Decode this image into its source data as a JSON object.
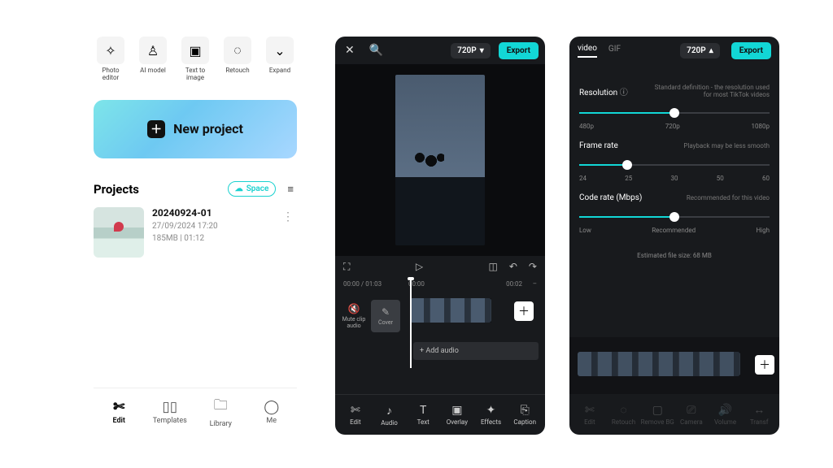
{
  "home": {
    "tools": [
      {
        "label": "Photo editor",
        "icon": "✧"
      },
      {
        "label": "AI model",
        "icon": "♙"
      },
      {
        "label": "Text to image",
        "icon": "▣"
      },
      {
        "label": "Retouch",
        "icon": "◌"
      },
      {
        "label": "Expand",
        "icon": "⌄"
      }
    ],
    "new_project_label": "New project",
    "projects_heading": "Projects",
    "space_pill": "Space",
    "project": {
      "title": "20240924-01",
      "date": "27/09/2024 17:20",
      "meta": "185MB  |  01:12"
    },
    "bottom_nav": [
      {
        "label": "Edit",
        "icon": "✄",
        "active": true
      },
      {
        "label": "Templates",
        "icon": "▯▯"
      },
      {
        "label": "Library",
        "icon": "🗀"
      },
      {
        "label": "Me",
        "icon": "◯"
      }
    ]
  },
  "editor": {
    "resolution_pill": "720P",
    "export_label": "Export",
    "time_left": "00:00 / 01:03",
    "time_marks": [
      "00:00",
      "00:02"
    ],
    "mute_label": "Mute clip audio",
    "cover_label": "Cover",
    "add_audio": "+  Add audio",
    "nav": [
      {
        "label": "Edit",
        "icon": "✄"
      },
      {
        "label": "Audio",
        "icon": "♪"
      },
      {
        "label": "Text",
        "icon": "T"
      },
      {
        "label": "Overlay",
        "icon": "▣"
      },
      {
        "label": "Effects",
        "icon": "✦"
      },
      {
        "label": "Caption",
        "icon": "⎘"
      }
    ]
  },
  "export": {
    "tabs": {
      "video": "video",
      "gif": "GIF"
    },
    "resolution_pill": "720P",
    "export_label": "Export",
    "resolution": {
      "title": "Resolution",
      "hint": "Standard definition - the resolution used for most TikTok videos",
      "labels": [
        "480p",
        "720p",
        "1080p"
      ],
      "position_pct": 50
    },
    "framerate": {
      "title": "Frame rate",
      "hint": "Playback may be less smooth",
      "labels": [
        "24",
        "25",
        "30",
        "50",
        "60"
      ],
      "position_pct": 25
    },
    "coderate": {
      "title": "Code rate (Mbps)",
      "hint": "Recommended for this video",
      "labels": [
        "Low",
        "Recommended",
        "High"
      ],
      "position_pct": 50
    },
    "estimated": "Estimated file size: 68 MB"
  }
}
